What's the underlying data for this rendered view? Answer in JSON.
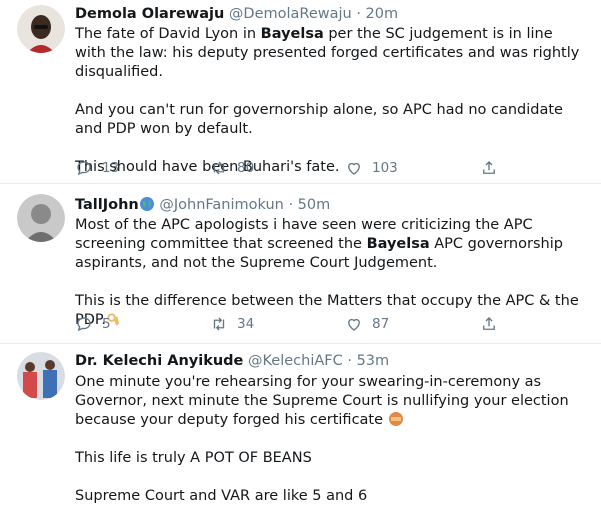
{
  "tweets": [
    {
      "name": "Demola Olarewaju",
      "handle": "@DemolaRewaju",
      "dot": "·",
      "time": "20m",
      "paragraphs": [
        [
          "The fate of David Lyon in ",
          "Bayelsa",
          " per the SC judgement is in line with the law: his deputy presented forged certificates and was rightly disqualified."
        ],
        [
          "And you can't run for governorship alone, so APC had no candidate and PDP won by default."
        ],
        [
          "This should have been Buhari's fate."
        ]
      ],
      "replies": "13",
      "retweets": "80",
      "likes": "103"
    },
    {
      "name": "TallJohn",
      "handle": "@JohnFanimokun",
      "dot": "·",
      "time": "50m",
      "paragraphs": [
        [
          "Most of the APC apologists i have seen were criticizing the APC screening committee that screened the ",
          "Bayelsa",
          " APC governorship aspirants, and not the Supreme Court Judgement."
        ],
        [
          "This is the difference between the Matters that occupy the APC & the PDP."
        ]
      ],
      "replies": "5",
      "retweets": "34",
      "likes": "87"
    },
    {
      "name": "Dr. Kelechi Anyikude",
      "handle": "@KelechiAFC",
      "dot": "·",
      "time": "53m",
      "paragraphs": [
        [
          "One minute you're rehearsing for your swearing-in-ceremony as Governor, next minute the Supreme Court is nullifying your election because your deputy forged his certificate"
        ],
        [
          "This life is truly A POT OF BEANS"
        ],
        [
          "Supreme Court and VAR are like 5 and 6"
        ]
      ]
    }
  ],
  "icons": {
    "reply": "speech-bubble-icon",
    "retweet": "retweet-arrows-icon",
    "like": "heart-icon",
    "share": "share-upload-icon"
  },
  "colors": {
    "text": "#14171a",
    "muted": "#657786",
    "divider": "#e6ecf0"
  }
}
